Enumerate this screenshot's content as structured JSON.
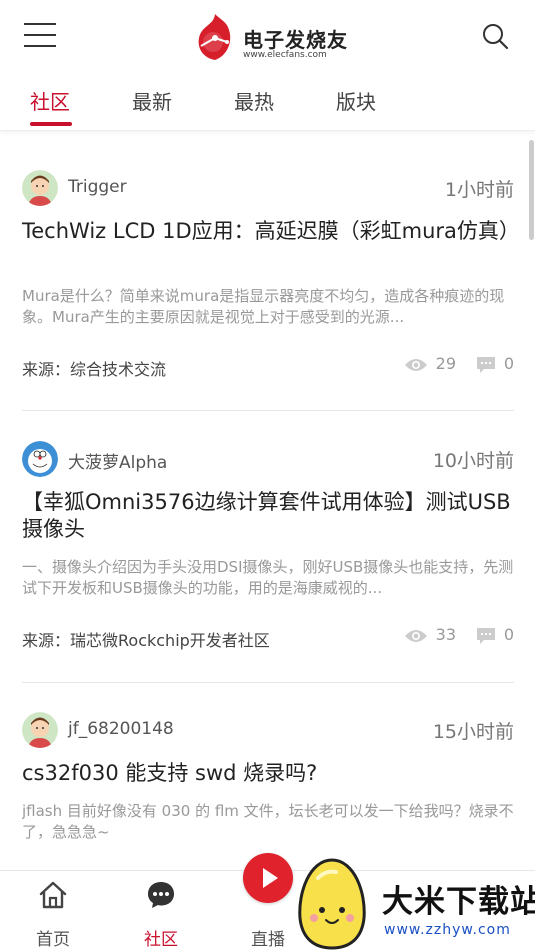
{
  "header": {
    "logo_text": "电子发烧友",
    "logo_sub": "www.elecfans.com"
  },
  "tabs": [
    {
      "label": "社区",
      "active": true
    },
    {
      "label": "最新",
      "active": false
    },
    {
      "label": "最热",
      "active": false
    },
    {
      "label": "版块",
      "active": false
    }
  ],
  "posts": [
    {
      "author": "Trigger",
      "time": "1小时前",
      "title": "TechWiz LCD 1D应用：高延迟膜（彩虹mura仿真）",
      "excerpt": "Mura是什么？简单来说mura是指显示器亮度不均匀，造成各种痕迹的现象。Mura产生的主要原因就是视觉上对于感受到的光源...",
      "source": "来源：综合技术交流",
      "views": "29",
      "comments": "0"
    },
    {
      "author": "大菠萝Alpha",
      "time": "10小时前",
      "title": "【幸狐Omni3576边缘计算套件试用体验】测试USB 摄像头",
      "excerpt": "一、摄像头介绍因为手头没用DSI摄像头，刚好USB摄像头也能支持，先测试下开发板和USB摄像头的功能，用的是海康威视的...",
      "source": "来源：瑞芯微Rockchip开发者社区",
      "views": "33",
      "comments": "0"
    },
    {
      "author": "jf_68200148",
      "time": "15小时前",
      "title": "cs32f030 能支持 swd 烧录吗?",
      "excerpt": "jflash 目前好像没有 030 的 flm 文件，坛长老可以发一下给我吗？烧录不了，急急急~",
      "source": "",
      "views": "",
      "comments": ""
    }
  ],
  "bottom_nav": [
    {
      "label": "首页",
      "icon": "home-icon",
      "active": false
    },
    {
      "label": "社区",
      "icon": "chat-icon",
      "active": true
    },
    {
      "label": "直播",
      "icon": "play-icon",
      "active": false
    }
  ],
  "watermark": {
    "text": "大米下载站",
    "url": "www.zzhyw.com"
  },
  "colors": {
    "accent": "#c8102e",
    "live": "#e0222c"
  }
}
